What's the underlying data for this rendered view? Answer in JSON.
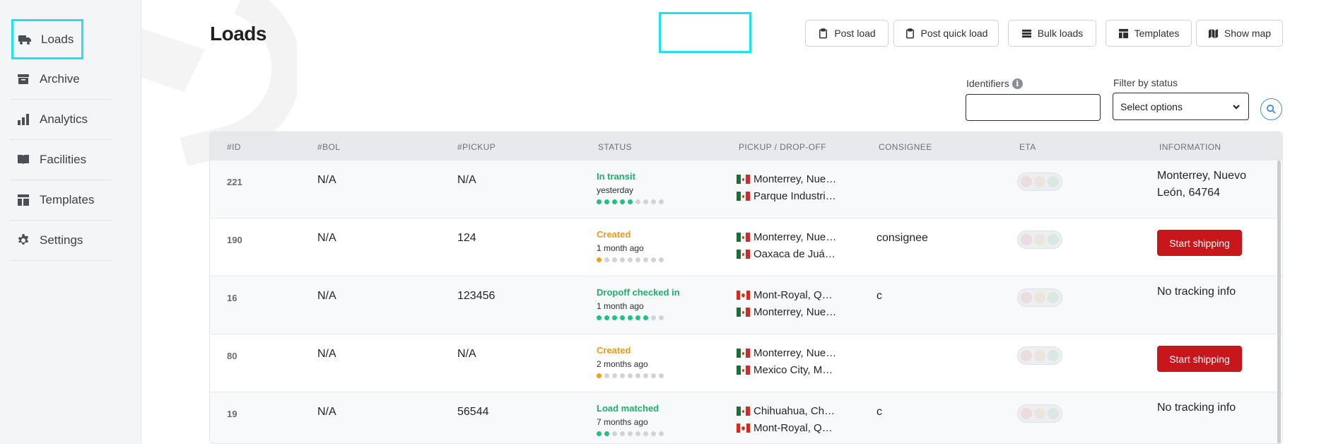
{
  "sidebar": {
    "items": [
      {
        "label": "Loads",
        "icon": "truck-icon"
      },
      {
        "label": "Archive",
        "icon": "archive-box-icon"
      },
      {
        "label": "Analytics",
        "icon": "bar-chart-icon"
      },
      {
        "label": "Facilities",
        "icon": "book-icon"
      },
      {
        "label": "Templates",
        "icon": "layout-icon"
      },
      {
        "label": "Settings",
        "icon": "gear-icon"
      }
    ]
  },
  "header": {
    "title": "Loads",
    "buttons": {
      "post_load": "Post load",
      "post_quick_load": "Post quick load",
      "bulk_loads": "Bulk loads",
      "templates": "Templates",
      "show_map": "Show map"
    }
  },
  "filters": {
    "identifiers_label": "Identifiers",
    "identifiers_value": "",
    "status_label": "Filter by status",
    "status_value": "Select options"
  },
  "table": {
    "columns": [
      "#ID",
      "#BOL",
      "#PICKUP",
      "STATUS",
      "PICKUP / DROP-OFF",
      "CONSIGNEE",
      "ETA",
      "INFORMATION"
    ],
    "rows": [
      {
        "id": "221",
        "bol": "N/A",
        "pickup": "N/A",
        "status": "In transit",
        "status_color": "#1eae6b",
        "time": "yesterday",
        "progress": 5,
        "origin": "Monterrey, Nue…",
        "origin_flag": "mx",
        "dest": "Parque Industri…",
        "dest_flag": "mx",
        "consignee": "",
        "info_type": "text",
        "info": "Monterrey, Nuevo León, 64764"
      },
      {
        "id": "190",
        "bol": "N/A",
        "pickup": "124",
        "status": "Created",
        "status_color": "#e99a18",
        "time": "1 month ago",
        "progress": 1,
        "origin": "Monterrey, Nue…",
        "origin_flag": "mx",
        "dest": "Oaxaca de Juá…",
        "dest_flag": "mx",
        "consignee": "consignee",
        "info_type": "button",
        "info": "Start shipping"
      },
      {
        "id": "16",
        "bol": "N/A",
        "pickup": "123456",
        "status": "Dropoff checked in",
        "status_color": "#1eae6b",
        "time": "1 month ago",
        "progress": 7,
        "origin": "Mont-Royal, Q…",
        "origin_flag": "ca",
        "dest": "Monterrey, Nue…",
        "dest_flag": "mx",
        "consignee": "c",
        "info_type": "text",
        "info": "No tracking info"
      },
      {
        "id": "80",
        "bol": "N/A",
        "pickup": "N/A",
        "status": "Created",
        "status_color": "#e99a18",
        "time": "2 months ago",
        "progress": 1,
        "origin": "Monterrey, Nue…",
        "origin_flag": "mx",
        "dest": "Mexico City, M…",
        "dest_flag": "mx",
        "consignee": "",
        "info_type": "button",
        "info": "Start shipping"
      },
      {
        "id": "19",
        "bol": "N/A",
        "pickup": "56544",
        "status": "Load matched",
        "status_color": "#1eae6b",
        "time": "7 months ago",
        "progress": 2,
        "origin": "Chihuahua, Ch…",
        "origin_flag": "mx",
        "dest": "Mont-Royal, Q…",
        "dest_flag": "ca",
        "consignee": "c",
        "info_type": "text",
        "info": "No tracking info"
      }
    ]
  }
}
